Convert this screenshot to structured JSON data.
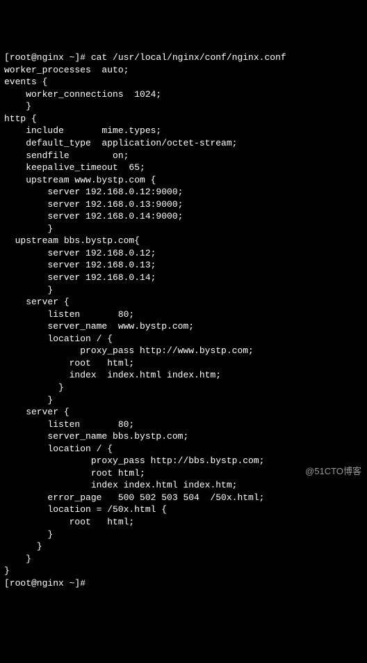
{
  "terminal": {
    "lines": [
      "[root@nginx ~]# cat /usr/local/nginx/conf/nginx.conf",
      "worker_processes  auto;",
      "events {",
      "    worker_connections  1024;",
      "    }",
      "http {",
      "    include       mime.types;",
      "    default_type  application/octet-stream;",
      "    sendfile        on;",
      "    keepalive_timeout  65;",
      "    upstream www.bystp.com {",
      "        server 192.168.0.12:9000;",
      "        server 192.168.0.13:9000;",
      "        server 192.168.0.14:9000;",
      "        }",
      "  upstream bbs.bystp.com{",
      "        server 192.168.0.12;",
      "        server 192.168.0.13;",
      "        server 192.168.0.14;",
      "        }",
      "    server {",
      "        listen       80;",
      "        server_name  www.bystp.com;",
      "        location / {",
      "              proxy_pass http://www.bystp.com;",
      "            root   html;",
      "            index  index.html index.htm;",
      "          }",
      "        }",
      "    server {",
      "        listen       80;",
      "        server_name bbs.bystp.com;",
      "        location / {",
      "                proxy_pass http://bbs.bystp.com;",
      "                root html;",
      "                index index.html index.htm;",
      "        error_page   500 502 503 504  /50x.html;",
      "        location = /50x.html {",
      "            root   html;",
      "        }",
      "      }",
      "    }",
      "}",
      "[root@nginx ~]#"
    ]
  },
  "watermark": "@51CTO博客"
}
